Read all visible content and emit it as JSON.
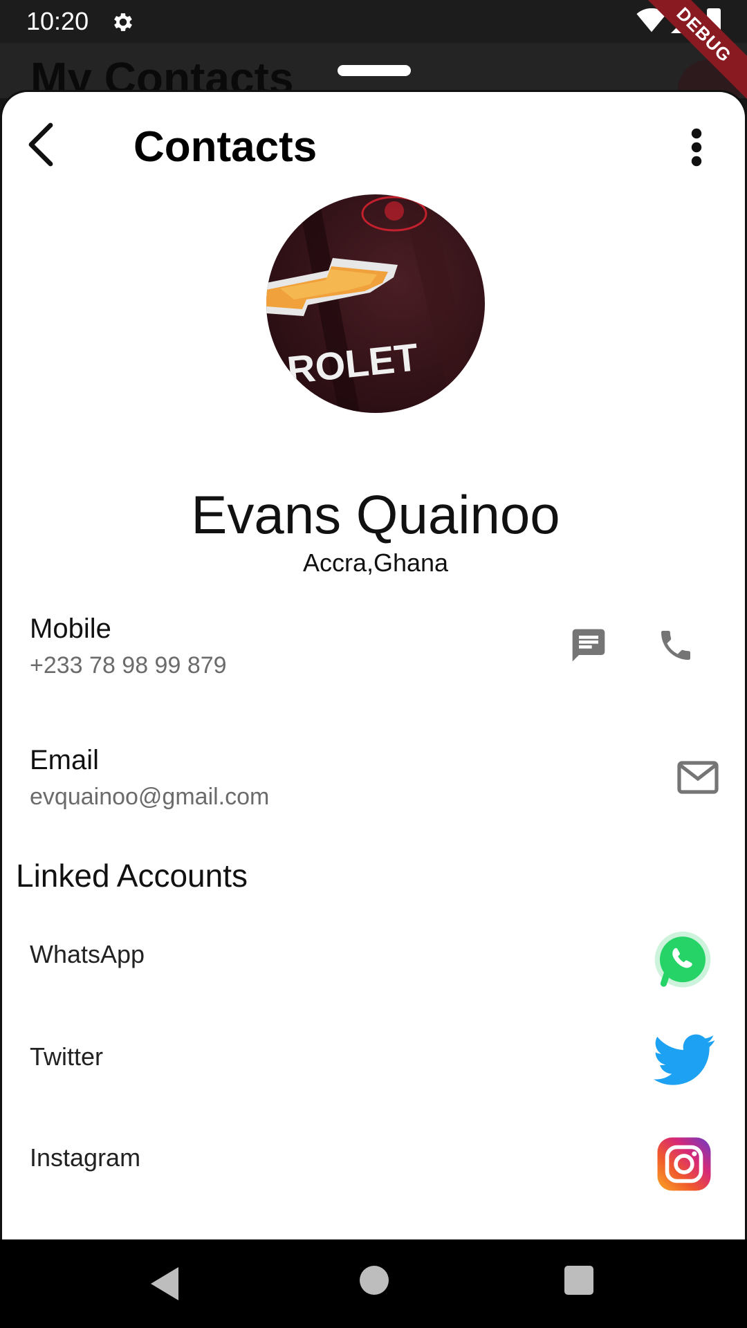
{
  "status_bar": {
    "time": "10:20",
    "debug_label": "DEBUG"
  },
  "background_app": {
    "title": "My Contacts"
  },
  "header": {
    "title": "Contacts"
  },
  "profile": {
    "avatar_text": "ROLET",
    "name": "Evans Quainoo",
    "location": "Accra,Ghana"
  },
  "mobile": {
    "label": "Mobile",
    "value": "+233 78 98 99 879"
  },
  "email": {
    "label": "Email",
    "value": "evquainoo@gmail.com"
  },
  "linked_accounts": {
    "title": "Linked Accounts",
    "items": [
      {
        "label": "WhatsApp",
        "icon": "whatsapp-icon"
      },
      {
        "label": "Twitter",
        "icon": "twitter-icon"
      },
      {
        "label": "Instagram",
        "icon": "instagram-icon"
      }
    ]
  },
  "colors": {
    "whatsapp": "#25D366",
    "twitter": "#1DA1F2",
    "icon_gray": "#757575",
    "debug_ribbon": "#8a1a22"
  }
}
